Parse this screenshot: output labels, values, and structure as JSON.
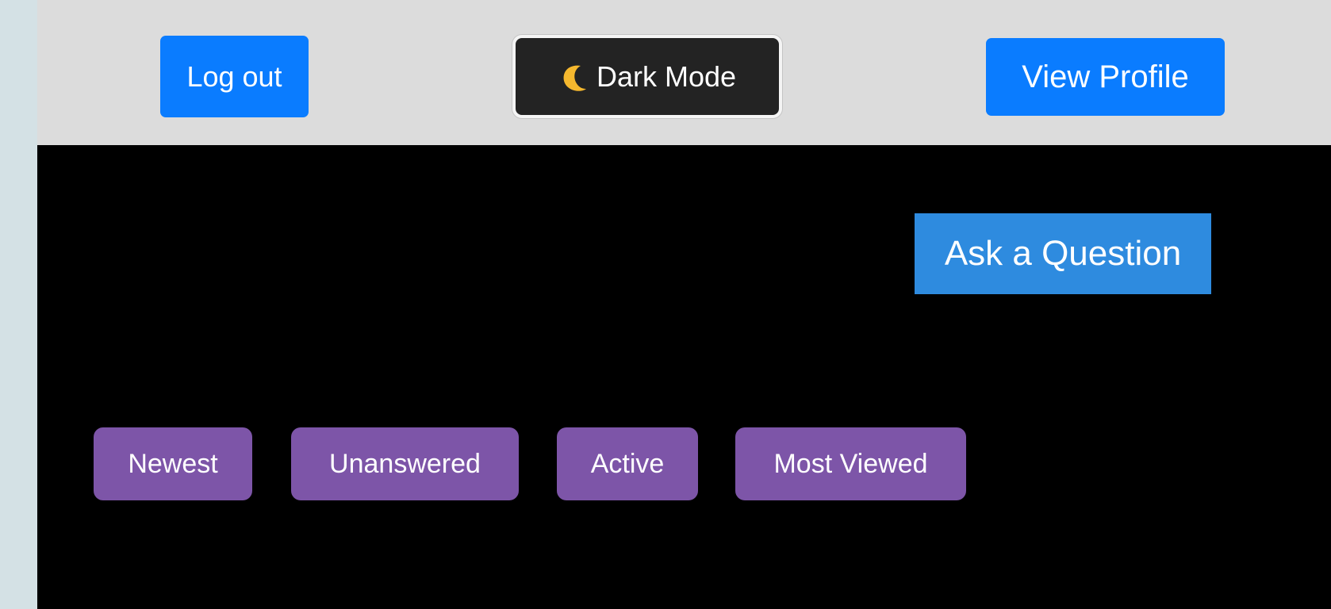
{
  "header": {
    "logout_label": "Log out",
    "dark_mode_label": "Dark Mode",
    "view_profile_label": "View Profile"
  },
  "main": {
    "ask_question_label": "Ask a Question",
    "filters": [
      {
        "label": "Newest"
      },
      {
        "label": "Unanswered"
      },
      {
        "label": "Active"
      },
      {
        "label": "Most Viewed"
      }
    ]
  },
  "colors": {
    "page_background": "#d4e1e5",
    "header_background": "#dcdcdc",
    "main_background": "#000000",
    "primary_blue": "#0a7cff",
    "ask_button_blue": "#2e8bdf",
    "dark_button": "#232323",
    "filter_purple": "#7d55a8",
    "moon_yellow": "#f5b82e"
  },
  "icons": {
    "dark_mode_icon": "crescent-moon"
  }
}
